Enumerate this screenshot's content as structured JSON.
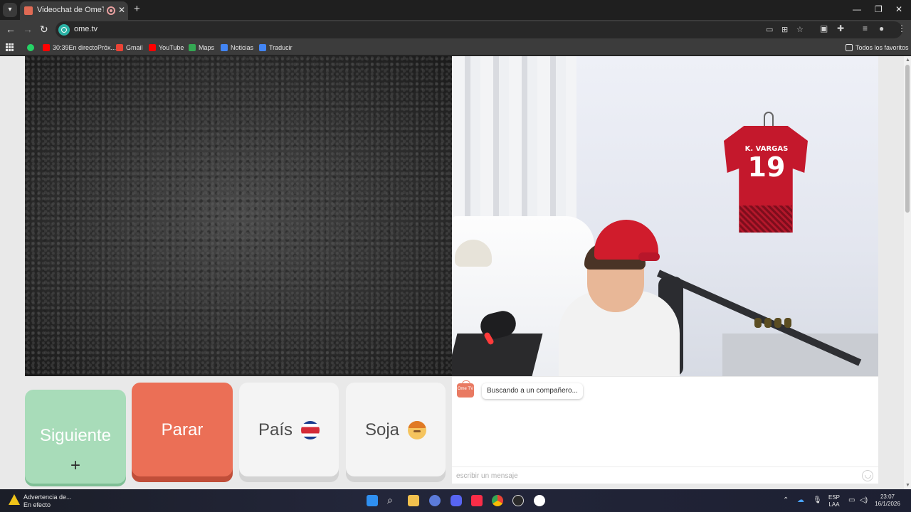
{
  "browser": {
    "tab_title": "Videochat de OmeTV: uno",
    "url": "ome.tv",
    "bookmarks": [
      {
        "label": "30:39En directoPróx...",
        "icon": "youtube-icon",
        "color": "#ff0000"
      },
      {
        "label": "Gmail",
        "icon": "gmail-icon",
        "color": "#ea4335"
      },
      {
        "label": "YouTube",
        "icon": "youtube-icon",
        "color": "#ff0000"
      },
      {
        "label": "Maps",
        "icon": "maps-icon",
        "color": "#34a853"
      },
      {
        "label": "Noticias",
        "icon": "news-icon",
        "color": "#4285f4"
      },
      {
        "label": "Traducir",
        "icon": "translate-icon",
        "color": "#4285f4"
      }
    ],
    "all_bookmarks": "Todos los favoritos"
  },
  "video": {
    "jersey_name": "K. VARGAS",
    "jersey_number": "19"
  },
  "controls": {
    "next_label": "Siguiente",
    "next_plus": "+",
    "stop_label": "Parar",
    "country_label": "País",
    "country_flag": "costa-rica-flag-icon",
    "gender_label": "Soja",
    "gender_icon": "boy-emoji-icon"
  },
  "chat": {
    "logo_text": "Ome TV",
    "status_message": "Buscando a un compañero...",
    "input_placeholder": "escribir un mensaje"
  },
  "taskbar": {
    "warning_title": "Advertencia de...",
    "warning_subtitle": "En efecto",
    "lang_top": "ESP",
    "lang_bottom": "LAA",
    "time": "23:07",
    "date": "16/1/2026"
  },
  "colors": {
    "next_button": "#a8dcb9",
    "stop_button": "#eb6f56",
    "neutral_button": "#f4f4f4",
    "brand": "#e97a62"
  }
}
